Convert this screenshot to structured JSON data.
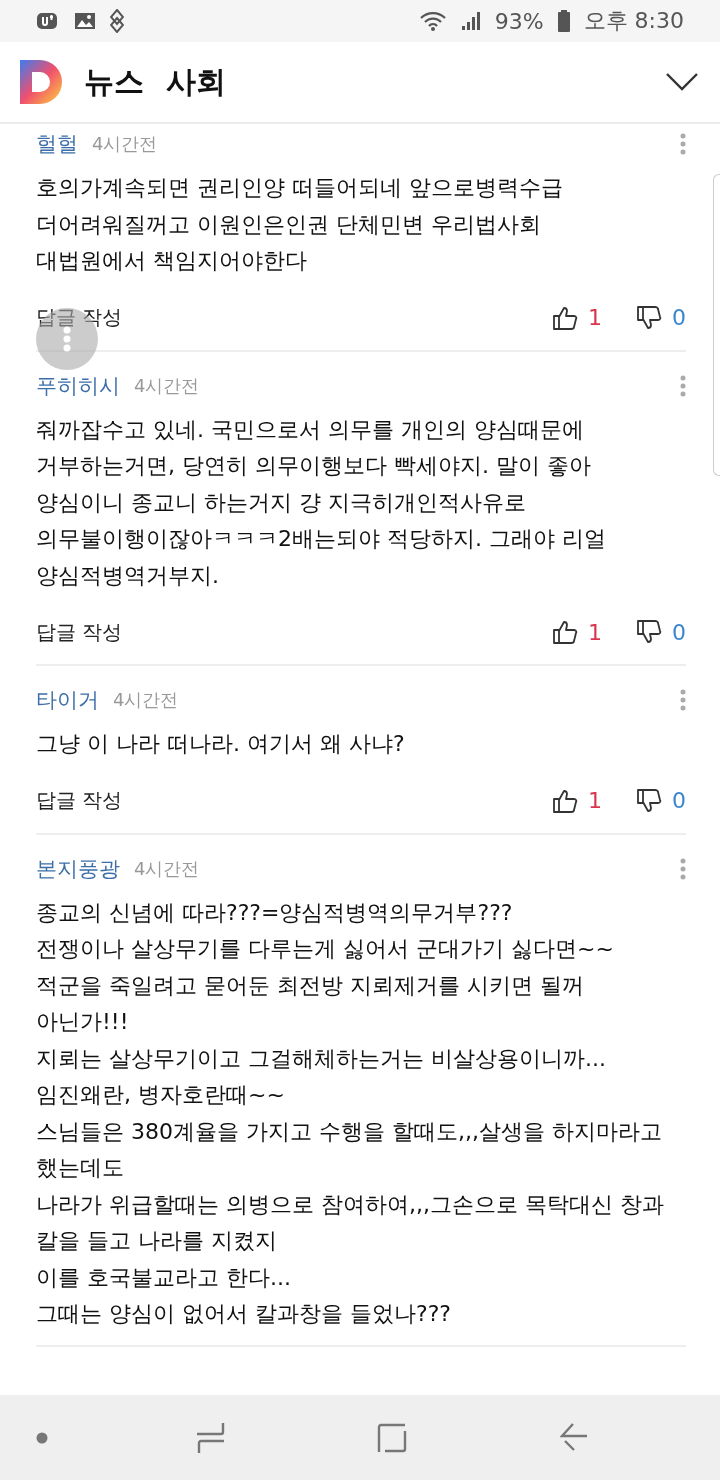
{
  "status_bar": {
    "battery": "93%",
    "time": "오후 8:30"
  },
  "header": {
    "section": "뉴스",
    "category": "사회"
  },
  "comments": [
    {
      "author": "헐헐",
      "time": "4시간전",
      "body": "호의가계속되면 권리인양 떠들어되네  앞으로병력수급\n더어려워질꺼고 이원인은인권 단체민변 우리법사회\n대법원에서 책임지어야한다",
      "reply": "답글 작성",
      "likes": "1",
      "dislikes": "0"
    },
    {
      "author": "푸히히시",
      "time": "4시간전",
      "body": "줘까잡수고 있네. 국민으로서 의무를 개인의 양심때문에\n거부하는거면, 당연히 의무이행보다 빡세야지. 말이 좋아\n양심이니 종교니 하는거지 걍 지극히개인적사유로\n의무불이행이잖아ㅋㅋㅋ2배는되야 적당하지. 그래야 리얼\n양심적병역거부지.",
      "reply": "답글 작성",
      "likes": "1",
      "dislikes": "0"
    },
    {
      "author": "타이거",
      "time": "4시간전",
      "body": "그냥 이 나라 떠나라. 여기서 왜 사냐?",
      "reply": "답글 작성",
      "likes": "1",
      "dislikes": "0"
    },
    {
      "author": "본지풍광",
      "time": "4시간전",
      "body": "종교의 신념에 따라???=양심적병역의무거부???\n전쟁이나 살상무기를 다루는게 싫어서 군대가기 싫다면~~\n적군을 죽일려고 묻어둔  최전방 지뢰제거를 시키면 될꺼\n아닌가!!!\n지뢰는 살상무기이고  그걸해체하는거는 비살상용이니까...\n임진왜란, 병자호란때~~\n스님들은 380계율을 가지고 수행을 할때도,,,살생을 하지마라고\n했는데도\n나라가 위급할때는 의병으로 참여하여,,,그손으로 목탁대신 창과\n칼을 들고 나라를 지켰지\n이를  호국불교라고 한다...\n그때는 양심이 없어서 칼과창을 들었나???"
    }
  ]
}
